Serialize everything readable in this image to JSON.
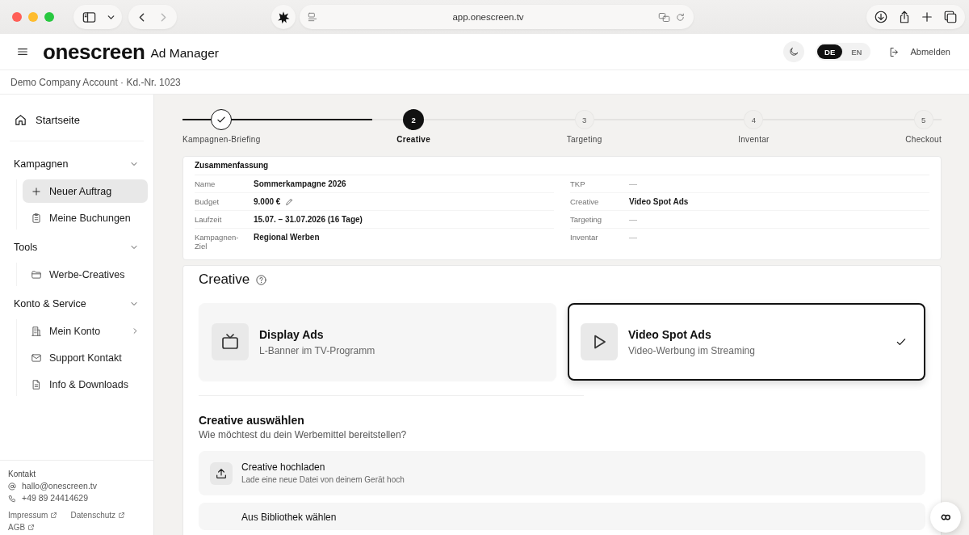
{
  "browser": {
    "url": "app.onescreen.tv",
    "back": {
      "disabled": false
    },
    "forward": {
      "disabled": true
    }
  },
  "header": {
    "logo": "onescreen",
    "product": "Ad Manager",
    "languages": [
      {
        "label": "DE",
        "selected": true
      },
      {
        "label": "EN",
        "selected": false
      }
    ],
    "logout": "Abmelden"
  },
  "account": {
    "text": "Demo Company Account · Kd.-Nr. 1023"
  },
  "sidebar": {
    "home": {
      "label": "Startseite",
      "selected": false
    },
    "sections": [
      {
        "title": "Kampagnen",
        "expanded": true,
        "items": [
          {
            "label": "Neuer Auftrag",
            "selected": true,
            "has_submenu": false
          },
          {
            "label": "Meine Buchungen",
            "selected": false,
            "has_submenu": false
          }
        ]
      },
      {
        "title": "Tools",
        "expanded": true,
        "items": [
          {
            "label": "Werbe-Creatives",
            "selected": false,
            "has_submenu": false
          }
        ]
      },
      {
        "title": "Konto & Service",
        "expanded": true,
        "items": [
          {
            "label": "Mein Konto",
            "selected": false,
            "has_submenu": true
          },
          {
            "label": "Support Kontakt",
            "selected": false,
            "has_submenu": false
          },
          {
            "label": "Info & Downloads",
            "selected": false,
            "has_submenu": false
          }
        ]
      }
    ],
    "footer": {
      "title": "Kontakt",
      "email": "hallo@onescreen.tv",
      "phone": "+49 89 24414629",
      "links": [
        "Impressum",
        "Datenschutz",
        "AGB"
      ]
    }
  },
  "stepper": {
    "level": 0.25,
    "steps": [
      {
        "label": "Kampagnen-Briefing",
        "completed": true,
        "selected": false
      },
      {
        "number": "2",
        "label": "Creative",
        "completed": false,
        "selected": true
      },
      {
        "number": "3",
        "label": "Targeting",
        "completed": false,
        "selected": false
      },
      {
        "number": "4",
        "label": "Inventar",
        "completed": false,
        "selected": false
      },
      {
        "number": "5",
        "label": "Checkout",
        "completed": false,
        "selected": false
      }
    ]
  },
  "summary": {
    "title": "Zusammenfassung",
    "left": [
      {
        "label": "Name",
        "value": "Sommerkampagne 2026",
        "empty": false,
        "editable": false
      },
      {
        "label": "Budget",
        "value": "9.000 €",
        "empty": false,
        "editable": true
      },
      {
        "label": "Laufzeit",
        "value": "15.07. – 31.07.2026 (16 Tage)",
        "empty": false,
        "editable": false
      },
      {
        "label": "Kampagnen-Ziel",
        "value": "Regional Werben",
        "empty": false,
        "editable": false
      }
    ],
    "right": [
      {
        "label": "TKP",
        "value": "—",
        "empty": true,
        "editable": false
      },
      {
        "label": "Creative",
        "value": "Video Spot Ads",
        "empty": false,
        "editable": false
      },
      {
        "label": "Targeting",
        "value": "—",
        "empty": true,
        "editable": false
      },
      {
        "label": "Inventar",
        "value": "—",
        "empty": true,
        "editable": false
      }
    ]
  },
  "creative": {
    "title": "Creative",
    "types": [
      {
        "title": "Display Ads",
        "subtitle": "L-Banner im TV-Programm",
        "selected": false
      },
      {
        "title": "Video Spot Ads",
        "subtitle": "Video-Werbung im Streaming",
        "selected": true
      }
    ],
    "source": {
      "title": "Creative auswählen",
      "subtitle": "Wie möchtest du dein Werbemittel bereitstellen?",
      "options": [
        {
          "title": "Creative hochladen",
          "subtitle": "Lade eine neue Datei von deinem Gerät hoch"
        },
        {
          "title": "Aus Bibliothek wählen"
        }
      ]
    }
  }
}
